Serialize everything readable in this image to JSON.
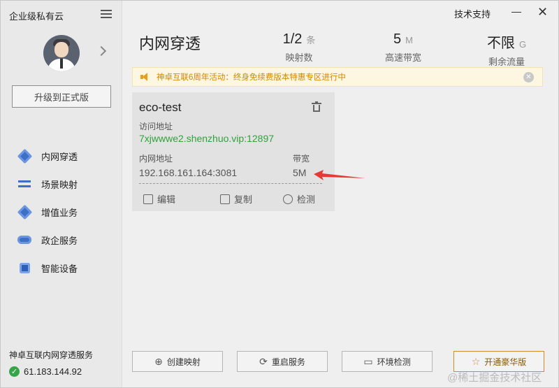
{
  "app": {
    "brand": "企业级私有云",
    "support": "技术支持",
    "close_glyph": "✕"
  },
  "sidebar": {
    "upgrade_label": "升级到正式版",
    "items": [
      {
        "label": "内网穿透",
        "icon": "tunnel-icon"
      },
      {
        "label": "场景映射",
        "icon": "scene-map-icon"
      },
      {
        "label": "增值业务",
        "icon": "value-added-icon"
      },
      {
        "label": "政企服务",
        "icon": "gov-service-icon"
      },
      {
        "label": "智能设备",
        "icon": "smart-device-icon"
      }
    ],
    "service_title": "神卓互联内网穿透服务",
    "service_ip": "61.183.144.92",
    "status_color": "#35a549"
  },
  "header": {
    "title": "内网穿透",
    "stats": [
      {
        "value": "1/2",
        "unit": "条",
        "label": "映射数"
      },
      {
        "value": "5",
        "unit": "M",
        "label": "高速带宽"
      },
      {
        "value": "不限",
        "unit": "G",
        "label": "剩余流量"
      }
    ]
  },
  "banner": {
    "text": "神卓互联6周年活动：终身免续费版本特惠专区进行中",
    "color": "#d08a00"
  },
  "card": {
    "name": "eco-test",
    "access_label": "访问地址",
    "access_url": "7xjwwwe2.shenzhuo.vip:12897",
    "lan_label": "内网地址",
    "lan_value": "192.168.161.164:3081",
    "bw_label": "带宽",
    "bw_value": "5M",
    "actions": {
      "edit": "编辑",
      "copy": "复制",
      "check": "检测"
    },
    "accent": "#2fa33a"
  },
  "footer": {
    "create": "创建映射",
    "restart": "重启服务",
    "env_check": "环境检测",
    "vip": "开通豪华版"
  },
  "watermark": "@稀土掘金技术社区",
  "annotation_color": "#e53935"
}
